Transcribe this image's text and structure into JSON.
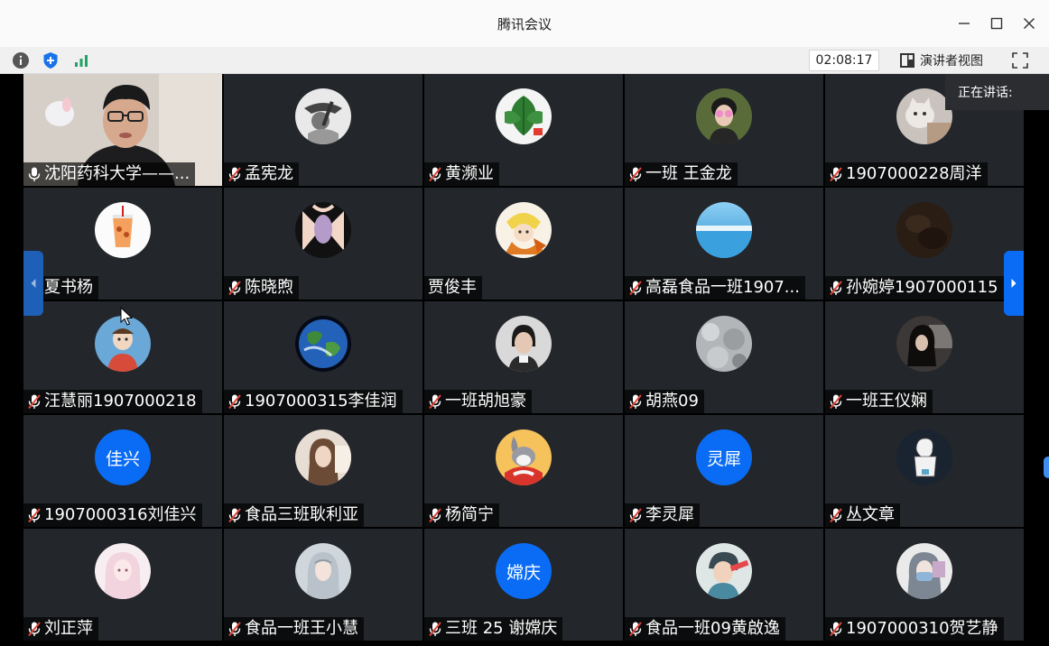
{
  "window": {
    "title": "腾讯会议"
  },
  "toolbar": {
    "timer": "02:08:17",
    "presenter_view_label": "演讲者视图"
  },
  "speaking_label": "正在讲话:",
  "participants": [
    {
      "name": "沈阳药科大学——...",
      "mic": "on",
      "video": true
    },
    {
      "name": "孟宪龙",
      "mic": "muted",
      "avatar": "bw-guitar-icon"
    },
    {
      "name": "黄濒业",
      "mic": "muted",
      "avatar": "green-leaf-icon"
    },
    {
      "name": "一班 王金龙",
      "mic": "muted",
      "avatar": "person-glasses-icon"
    },
    {
      "name": "1907000228周洋",
      "mic": "muted",
      "avatar": "cat-photo-icon"
    },
    {
      "name": "夏书杨",
      "mic": "muted",
      "avatar": "drink-cup-icon"
    },
    {
      "name": "陈晓煦",
      "mic": "muted",
      "avatar": "anime-girl-icon"
    },
    {
      "name": "贾俊丰",
      "mic": "none",
      "avatar": "cartoon-fox-icon"
    },
    {
      "name": "高磊食品一班1907...",
      "mic": "muted",
      "avatar": "lake-sky-icon"
    },
    {
      "name": "孙婉婷1907000115",
      "mic": "muted",
      "avatar": "dark-photo-icon"
    },
    {
      "name": "汪慧丽1907000218",
      "mic": "muted",
      "avatar": "child-photo-icon"
    },
    {
      "name": "1907000315李佳润",
      "mic": "muted",
      "avatar": "earth-icon"
    },
    {
      "name": "一班胡旭豪",
      "mic": "muted",
      "avatar": "portrait-icon"
    },
    {
      "name": "胡燕09",
      "mic": "muted",
      "avatar": "rock-texture-icon"
    },
    {
      "name": "一班王仪娴",
      "mic": "muted",
      "avatar": "girl-dark-icon"
    },
    {
      "name": "1907000316刘佳兴",
      "mic": "muted",
      "initials": "佳兴"
    },
    {
      "name": "食品三班耿利亚",
      "mic": "muted",
      "avatar": "girl-portrait-icon"
    },
    {
      "name": "杨简宁",
      "mic": "muted",
      "avatar": "cartoon-bunny-icon"
    },
    {
      "name": "李灵犀",
      "mic": "muted",
      "initials": "灵犀"
    },
    {
      "name": "丛文章",
      "mic": "muted",
      "avatar": "sketch-girl-icon"
    },
    {
      "name": "刘正萍",
      "mic": "muted",
      "avatar": "pink-anime-icon"
    },
    {
      "name": "食品一班王小慧",
      "mic": "muted",
      "avatar": "anime-long-hair-icon"
    },
    {
      "name": "三班 25 谢嫦庆",
      "mic": "muted",
      "initials": "嫦庆"
    },
    {
      "name": "食品一班09黄啟逸",
      "mic": "muted",
      "avatar": "boy-illustration-icon"
    },
    {
      "name": "1907000310贺艺静",
      "mic": "muted",
      "avatar": "girl-mask-icon"
    }
  ],
  "colors": {
    "tile_bg": "#23262b",
    "accent_blue": "#0a6cf5",
    "muted_red": "#e0463a"
  }
}
